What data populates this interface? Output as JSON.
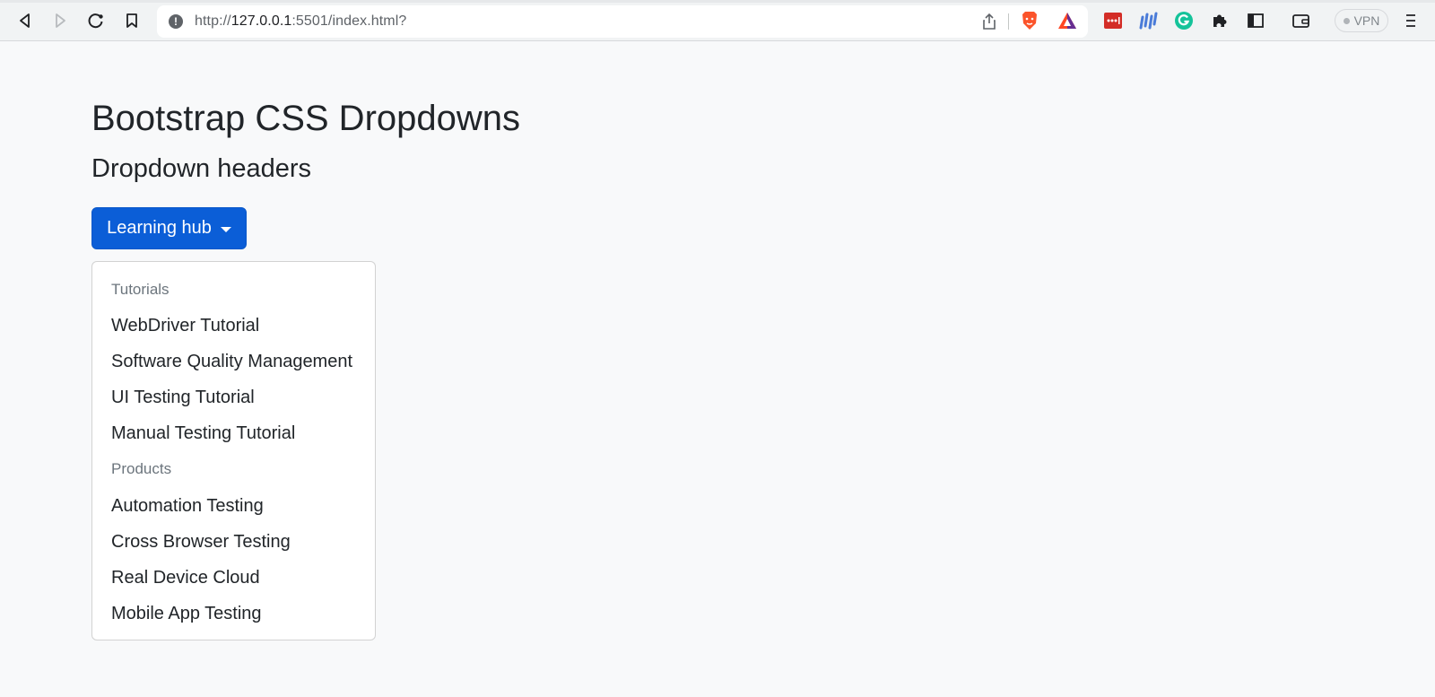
{
  "browser": {
    "url_prefix": "http://",
    "url_host": "127.0.0.1",
    "url_rest": ":5501/index.html?",
    "vpn_label": "VPN",
    "icons": [
      "back-icon",
      "forward-icon",
      "reload-icon",
      "bookmark-icon",
      "site-info-icon",
      "share-icon",
      "brave-shields-icon",
      "brave-rewards-icon",
      "lastpass-icon",
      "extension-bars-icon",
      "grammarly-icon",
      "extensions-puzzle-icon",
      "sidebar-icon",
      "wallet-icon",
      "menu-icon"
    ]
  },
  "page": {
    "title": "Bootstrap CSS Dropdowns",
    "subtitle": "Dropdown headers",
    "dropdown": {
      "toggle_label": "Learning hub",
      "sections": [
        {
          "header": "Tutorials",
          "items": [
            "WebDriver Tutorial",
            "Software Quality Management",
            "UI Testing Tutorial",
            "Manual Testing Tutorial"
          ]
        },
        {
          "header": "Products",
          "items": [
            "Automation Testing",
            "Cross Browser Testing",
            "Real Device Cloud",
            "Mobile App Testing"
          ]
        }
      ]
    }
  },
  "colors": {
    "primary": "#0b5ed7",
    "header_text": "#6c757d",
    "page_bg": "#f8f9fa"
  }
}
